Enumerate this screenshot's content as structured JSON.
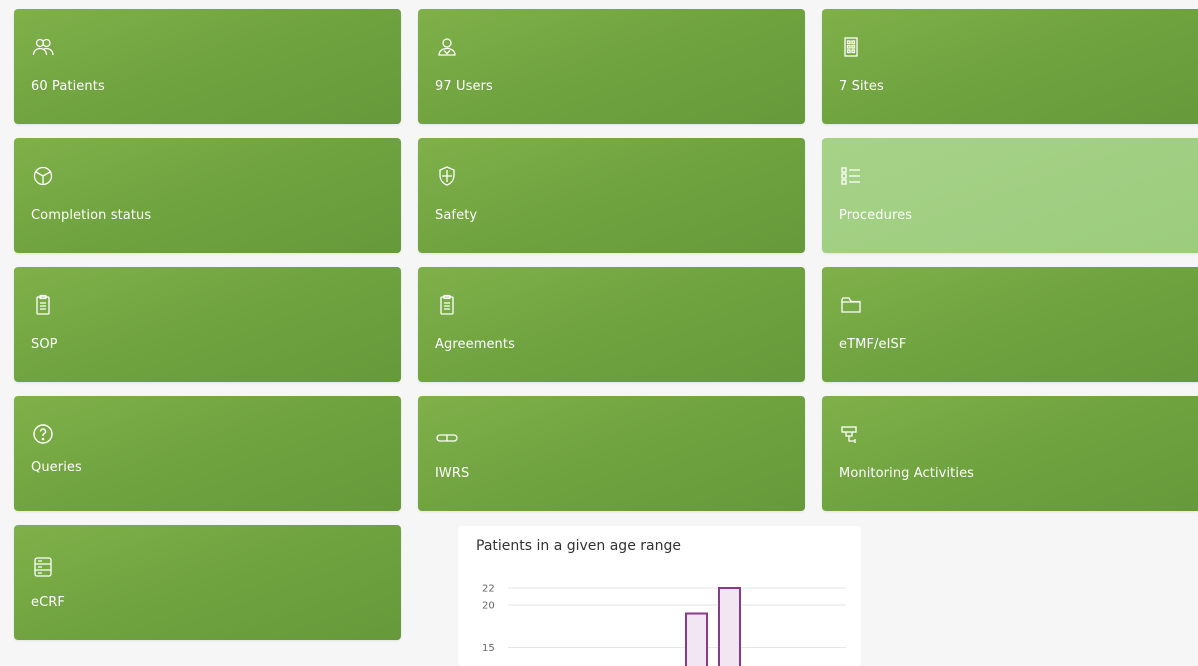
{
  "tiles": [
    {
      "label": "60 Patients",
      "icon": "patients-icon"
    },
    {
      "label": "97 Users",
      "icon": "user-icon"
    },
    {
      "label": "7 Sites",
      "icon": "building-icon"
    },
    {
      "label": "Completion status",
      "icon": "pie-chart-icon"
    },
    {
      "label": "Safety",
      "icon": "shield-icon"
    },
    {
      "label": "Procedures",
      "icon": "checklist-icon"
    },
    {
      "label": "SOP",
      "icon": "clipboard-icon"
    },
    {
      "label": "Agreements",
      "icon": "clipboard-icon"
    },
    {
      "label": "eTMF/eISF",
      "icon": "folder-icon"
    },
    {
      "label": "Queries",
      "icon": "question-icon"
    },
    {
      "label": "IWRS",
      "icon": "pill-icon"
    },
    {
      "label": "Monitoring Activities",
      "icon": "monitoring-camera-icon"
    },
    {
      "label": "eCRF",
      "icon": "server-icon"
    }
  ],
  "colors": {
    "tile": "#6fa33f",
    "tile_highlight": "#9ccc7e",
    "bar_stroke": "#8b3a8b",
    "bar_fill": "#f1e6f1"
  },
  "chart_data": {
    "type": "bar",
    "title": "Patients in a given age range",
    "y_ticks": [
      15,
      20,
      22
    ],
    "values": [
      19,
      22
    ],
    "ylim": [
      15,
      22
    ],
    "grid": true
  }
}
